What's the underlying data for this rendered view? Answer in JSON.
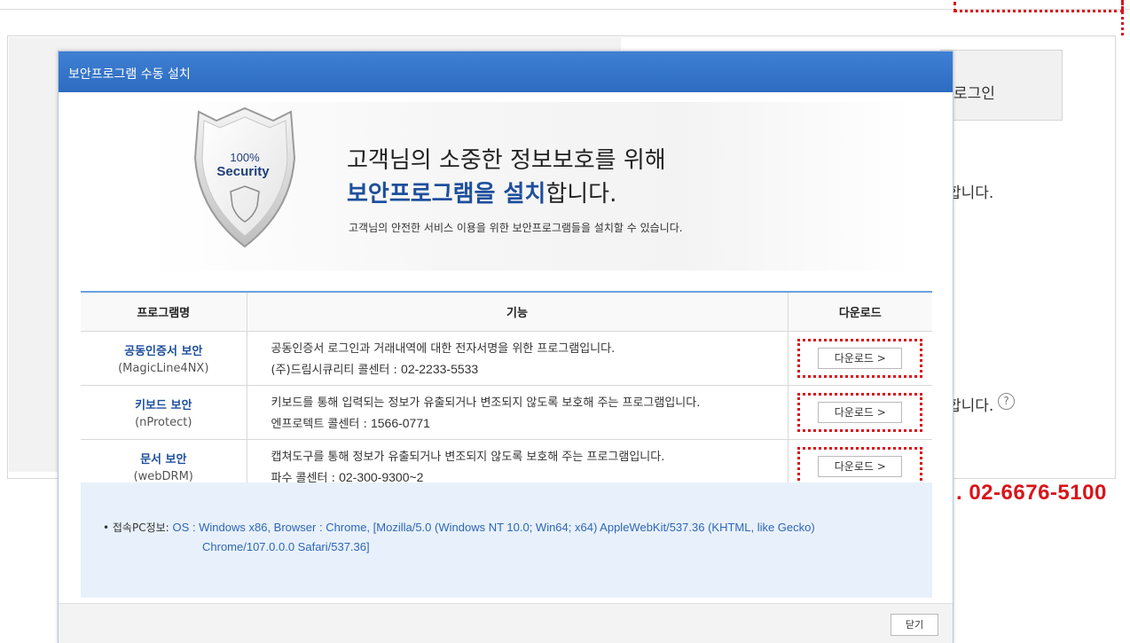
{
  "background": {
    "login_label": "로그인",
    "text1": "합니다.",
    "text2": "합니다.",
    "phone": ". 02-6676-5100",
    "help_icon": "?"
  },
  "modal": {
    "title": "보안프로그램 수동 설치",
    "hero": {
      "shield_line1": "100%",
      "shield_line2": "Security",
      "line1": "고객님의 소중한 정보보호를 위해",
      "line2_accent": "보안프로그램을 설치",
      "line2_rest": "합니다.",
      "sub": "고객님의 안전한 서비스 이용을 위한 보안프로그램들을 설치할 수 있습니다."
    },
    "table": {
      "headers": [
        "프로그램명",
        "기능",
        "다운로드"
      ],
      "rows": [
        {
          "name": "공동인증서 보안",
          "sub": "(MagicLine4NX)",
          "desc": "공동인증서 로그인과 거래내역에 대한 전자서명을 위한 프로그램입니다.",
          "contact_label": "(주)드림시큐리티 콜센터 : ",
          "contact_num": "02-2233-5533",
          "download": "다운로드  >"
        },
        {
          "name": "키보드 보안",
          "sub": "(nProtect)",
          "desc": "키보드를 통해 입력되는 정보가 유출되거나 변조되지 않도록 보호해 주는 프로그램입니다.",
          "contact_label": "엔프로텍트 콜센터 : ",
          "contact_num": "1566-0771",
          "download": "다운로드  >"
        },
        {
          "name": "문서 보안",
          "sub": "(webDRM)",
          "desc": "캡쳐도구를 통해 정보가 유출되거나 변조되지 않도록 보호해 주는 프로그램입니다.",
          "contact_label": "파수 콜센터 : ",
          "contact_num": "02-300-9300~2",
          "download": "다운로드  >"
        }
      ]
    },
    "info": {
      "label": "• 접속PC정보: ",
      "value_line1": "OS : Windows x86, Browser : Chrome, [Mozilla/5.0 (Windows NT 10.0; Win64; x64) AppleWebKit/537.36 (KHTML, like Gecko)",
      "value_line2": "Chrome/107.0.0.0 Safari/537.36]"
    },
    "close_label": "닫기"
  }
}
